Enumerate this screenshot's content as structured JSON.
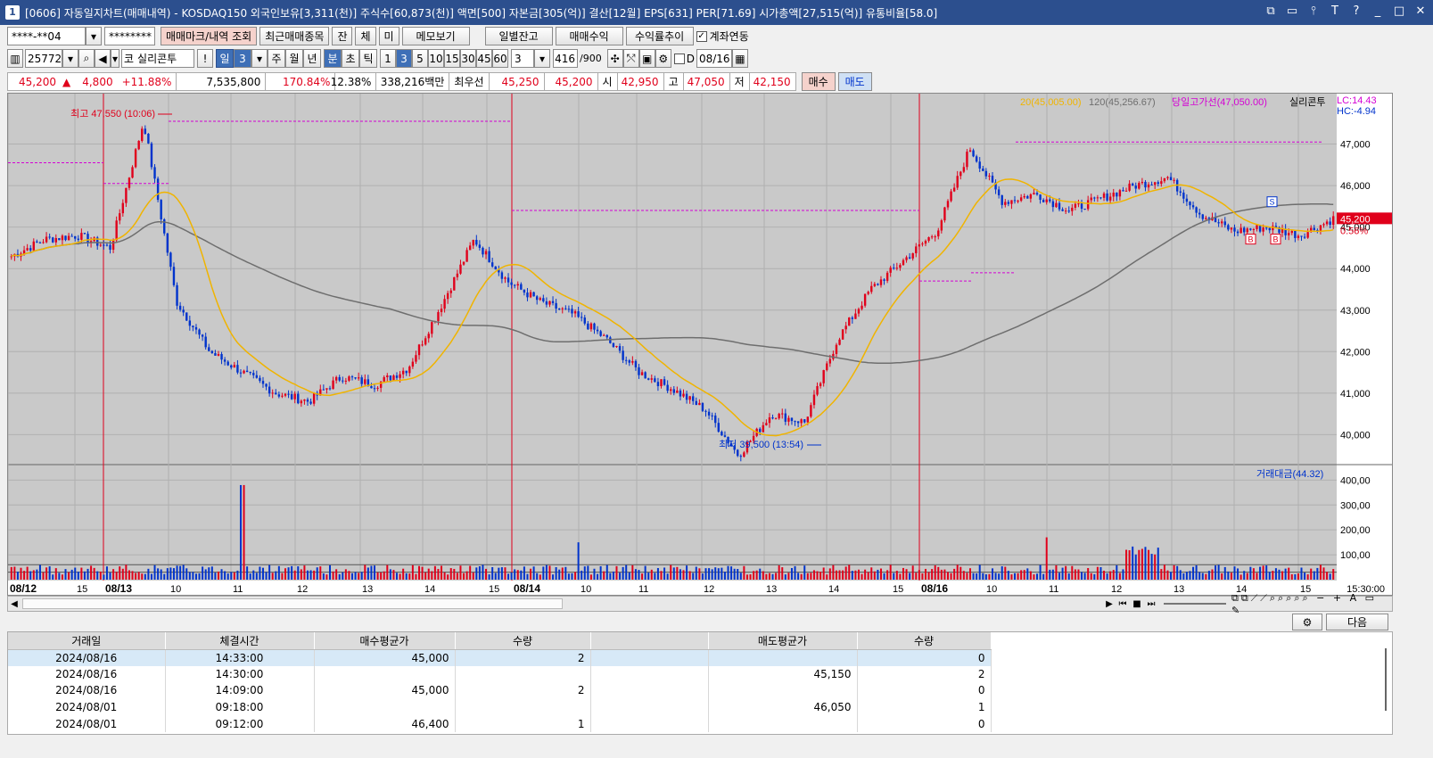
{
  "title": {
    "icon": "1",
    "text": "[0606] 자동일지차트(매매내역) - KOSDAQ150 외국인보유[3,311(천)] 주식수[60,873(천)] 액면[500] 자본금[305(억)] 결산[12월] EPS[631] PER[71.69] 시가총액[27,515(억)] 유통비율[58.0]"
  },
  "toolbar1": {
    "account": "****-**04",
    "password": "********",
    "btn_mark": "매매마크/내역 조회",
    "btn_recent": "최근매매종목",
    "btn_jan": "잔",
    "btn_che": "체",
    "btn_mi": "미",
    "btn_memo": "메모보기",
    "btn_daily": "일별잔고",
    "btn_profit": "매매수익",
    "btn_trend": "수익률추이",
    "check_link": "계좌연동"
  },
  "toolbar2": {
    "code": "257720",
    "market": "코",
    "name": "실리콘투",
    "period_day": "일",
    "period_num": "3",
    "week": "주",
    "month": "월",
    "year": "년",
    "min": "분",
    "sec": "초",
    "tick": "틱",
    "intervals": [
      "1",
      "3",
      "5",
      "10",
      "15",
      "30",
      "45",
      "60"
    ],
    "count": "3",
    "bars": "416",
    "bars_total": "/900",
    "date": "08/16"
  },
  "quote": {
    "price": "45,200",
    "arrow": "▲",
    "change": "4,800",
    "change_rate": "+11.88%",
    "volume": "7,535,800",
    "vol_rate": "170.84%",
    "turnover": "12.38%",
    "amount": "338,216백만",
    "best_label": "최우선",
    "best_ask": "45,250",
    "best_bid": "45,200",
    "open_label": "시",
    "open": "42,950",
    "high_label": "고",
    "high": "47,050",
    "low_label": "저",
    "low": "42,150",
    "buy": "매수",
    "sell": "매도"
  },
  "chart_legend": {
    "ma20": "20(45,005.00)",
    "ma120": "120(45,256.67)",
    "highline": "당일고가선(47,050.00)",
    "name": "실리콘투",
    "lc": "LC:14.43",
    "hc": "HC:-4.94",
    "vol_label": "거래대금(44.32)"
  },
  "annotations": {
    "high": "최고 47,550 (10:06)",
    "low": "최저 39,500 (13:54)",
    "cur_price": "45,200",
    "cur_rate": "0.56%"
  },
  "colors": {
    "up": "#e0001b",
    "down": "#0033cc",
    "ma20": "#f0b400",
    "ma120": "#6e6e6e",
    "highline": "#d400d4"
  },
  "chart_data": {
    "type": "candlestick",
    "price_axis": [
      "47,000",
      "46,000",
      "45,000",
      "44,000",
      "43,000",
      "42,000",
      "41,000",
      "40,000"
    ],
    "price_range": [
      39300,
      48000
    ],
    "volume_axis": [
      "400,00",
      "300,00",
      "200,00",
      "100,00"
    ],
    "volume_range": [
      0,
      430
    ],
    "time_labels": [
      "08/12",
      "15",
      "08/13",
      "10",
      "11",
      "12",
      "13",
      "14",
      "15",
      "08/14",
      "10",
      "11",
      "12",
      "13",
      "14",
      "15",
      "08/16",
      "10",
      "11",
      "12",
      "13",
      "14",
      "15"
    ],
    "time_end": "15:30:00",
    "key_closes": [
      44300,
      44700,
      44800,
      44500,
      47550,
      43200,
      42000,
      41500,
      41000,
      40800,
      41400,
      41200,
      41600,
      43100,
      44700,
      43700,
      43200,
      42900,
      42300,
      41500,
      41100,
      40600,
      39500,
      40500,
      40300,
      42300,
      43500,
      44200,
      44900,
      46900,
      45600,
      45800,
      45400,
      45700,
      46000,
      46200,
      45300,
      44900,
      45000,
      44800,
      45200
    ],
    "buy_marks": 2,
    "sell_marks": 1
  },
  "scroll": {
    "next": "다음"
  },
  "table": {
    "headers": [
      "거래일",
      "체결시간",
      "매수평균가",
      "수량",
      "",
      "매도평균가",
      "수량"
    ],
    "rows": [
      [
        "2024/08/16",
        "14:33:00",
        "45,000",
        "2",
        "",
        "",
        "0"
      ],
      [
        "2024/08/16",
        "14:30:00",
        "",
        "",
        "",
        "45,150",
        "2"
      ],
      [
        "2024/08/16",
        "14:09:00",
        "45,000",
        "2",
        "",
        "",
        "0"
      ],
      [
        "2024/08/01",
        "09:18:00",
        "",
        "",
        "",
        "46,050",
        "1"
      ],
      [
        "2024/08/01",
        "09:12:00",
        "46,400",
        "1",
        "",
        "",
        "0"
      ]
    ]
  }
}
